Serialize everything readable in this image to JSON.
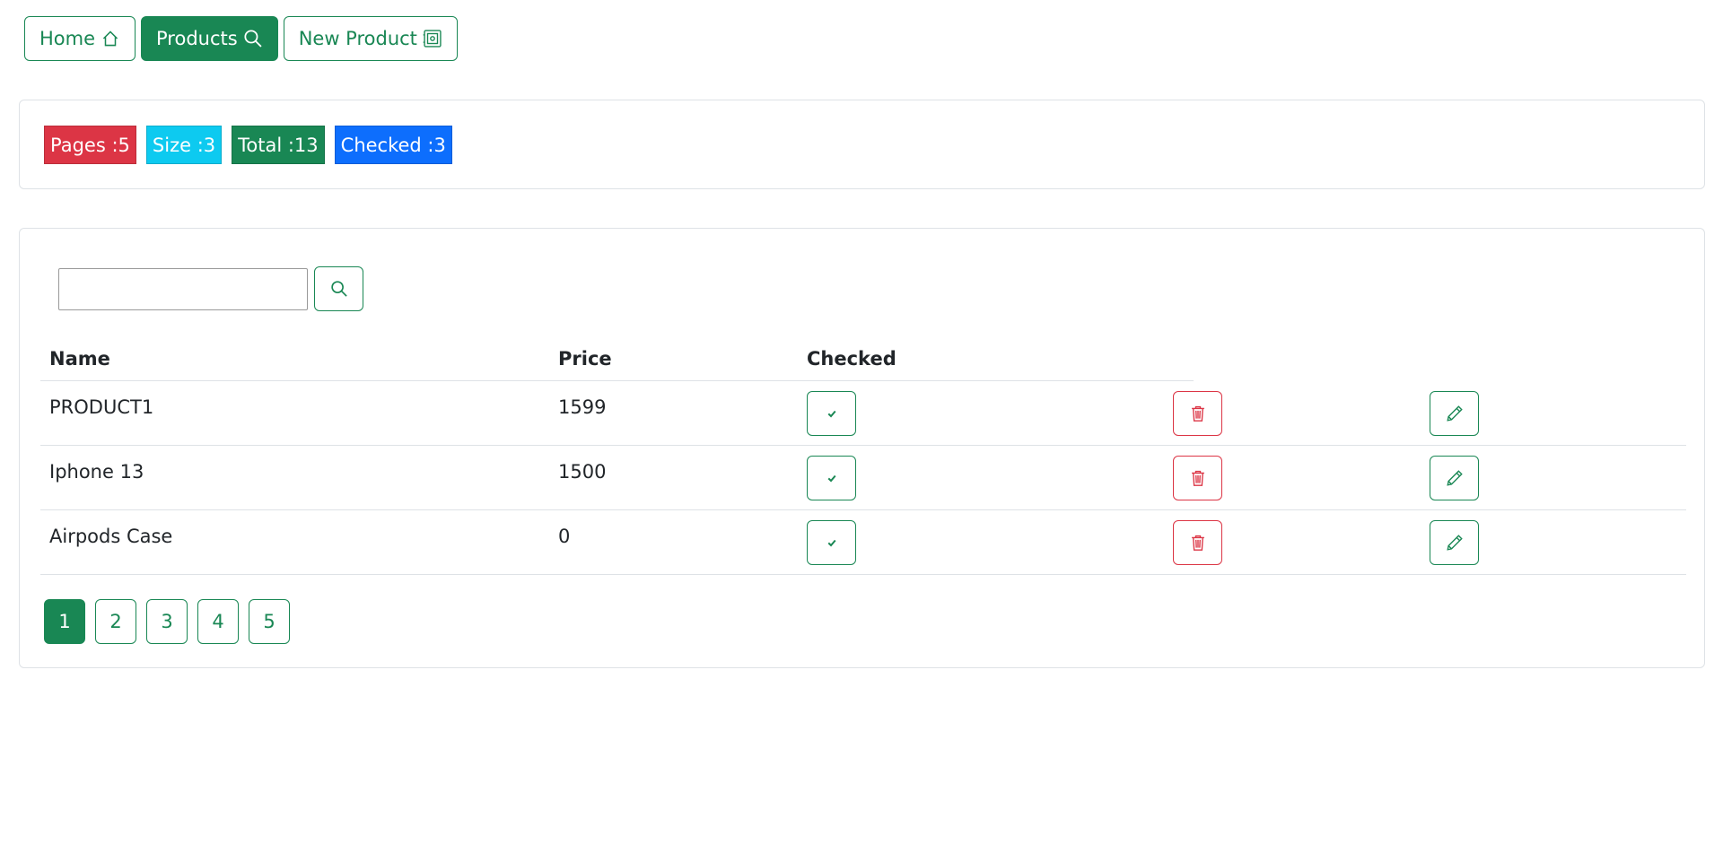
{
  "nav": {
    "home_label": "Home",
    "products_label": "Products",
    "new_product_label": "New Product"
  },
  "stats": {
    "pages": "Pages :5",
    "size": "Size :3",
    "total": "Total :13",
    "checked": "Checked :3"
  },
  "search": {
    "value": ""
  },
  "table": {
    "headers": {
      "name": "Name",
      "price": "Price",
      "checked": "Checked"
    },
    "rows": [
      {
        "name": "PRODUCT1",
        "price": "1599"
      },
      {
        "name": "Iphone 13",
        "price": "1500"
      },
      {
        "name": "Airpods Case",
        "price": "0"
      }
    ]
  },
  "pagination": {
    "pages": [
      "1",
      "2",
      "3",
      "4",
      "5"
    ],
    "current": "1"
  },
  "colors": {
    "primary": "#198754",
    "danger": "#dc3545",
    "info": "#0dcaf0",
    "blue": "#0d6efd"
  },
  "icons": {
    "home": "house-icon",
    "products": "search-icon",
    "new_product": "safe-icon",
    "check": "check-icon",
    "delete": "trash-icon",
    "edit": "pencil-icon"
  }
}
